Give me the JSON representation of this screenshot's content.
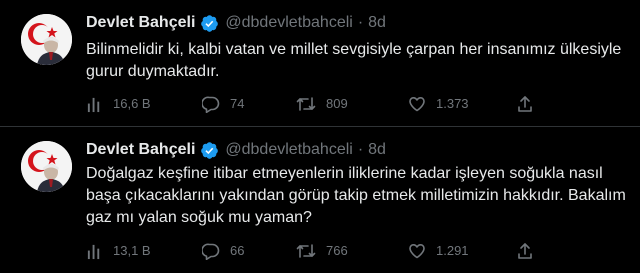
{
  "tweets": [
    {
      "author_name": "Devlet Bahçeli",
      "handle": "@dbdevletbahceli",
      "separator": "·",
      "time": "8d",
      "lines": [
        "Bilinmelidir ki, kalbi vatan ve millet sevgisiyle çarpan her insanımız ülkesiyle",
        "gurur duymaktadır."
      ],
      "views": "16,6 B",
      "replies": "74",
      "retweets": "809",
      "likes": "1.373"
    },
    {
      "author_name": "Devlet Bahçeli",
      "handle": "@dbdevletbahceli",
      "separator": "·",
      "time": "8d",
      "lines": [
        "Doğalgaz keşfine itibar etmeyenlerin iliklerine kadar işleyen soğukla nasıl",
        "başa çıkacaklarını yakından görüp takip etmek milletimizin hakkıdır. Bakalım",
        "gaz mı yalan soğuk mu yaman?"
      ],
      "views": "13,1 B",
      "replies": "66",
      "retweets": "766",
      "likes": "1.291"
    }
  ],
  "icons": {
    "verified": "verified-badge-icon",
    "views": "bar-chart-icon",
    "reply": "speech-bubble-icon",
    "retweet": "retweet-arrows-icon",
    "like": "heart-icon",
    "share": "upload-arrow-icon"
  },
  "colors": {
    "background": "#000000",
    "primary_text": "#e7e9ea",
    "secondary_text": "#71767b",
    "verified_blue": "#1d9bf0",
    "divider": "#2f3336"
  }
}
